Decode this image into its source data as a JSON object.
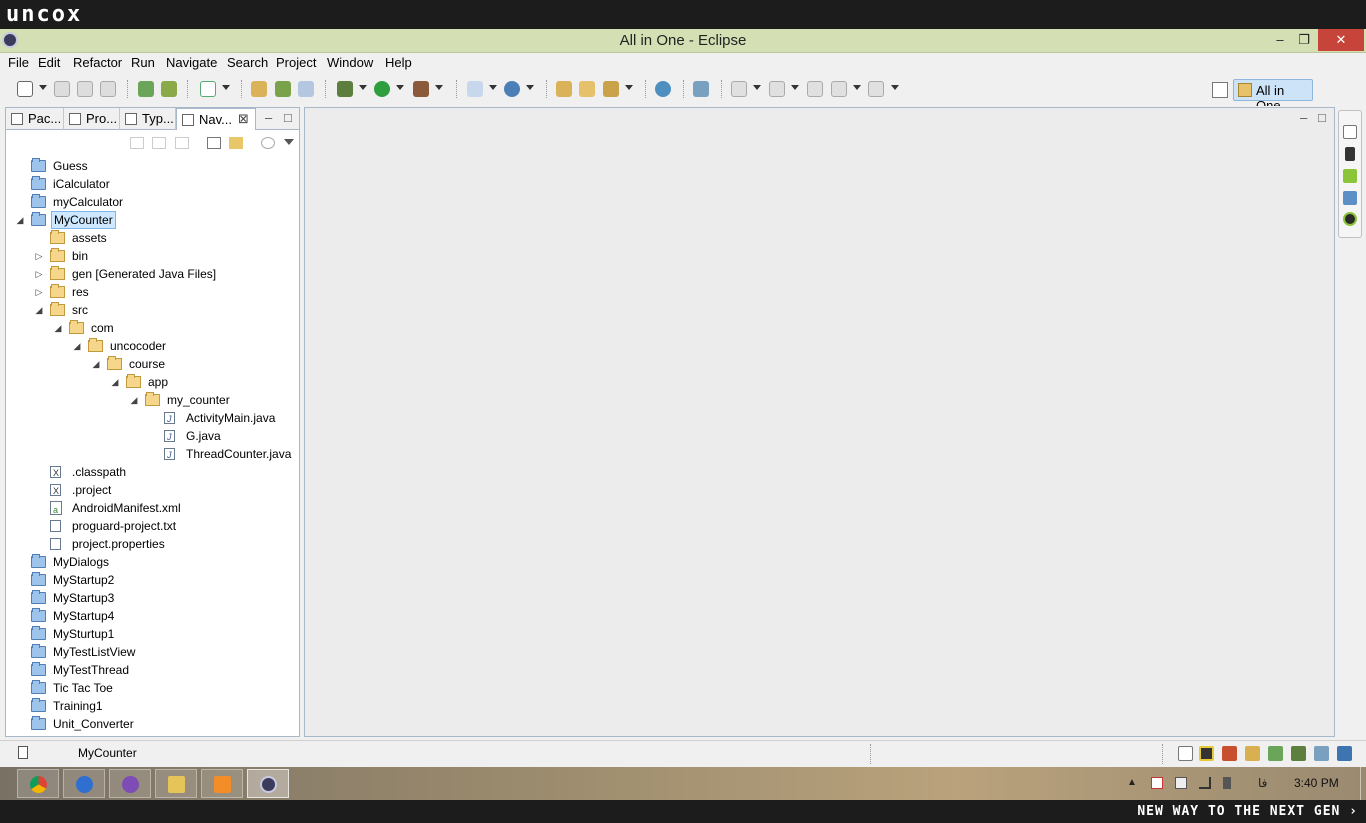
{
  "branding": {
    "logo": "uncox",
    "tagline": "NEW WAY TO THE NEXT GEN ›"
  },
  "window": {
    "title": "All in One - Eclipse",
    "minimize": "–",
    "maximize": "❐",
    "close": "✕"
  },
  "menubar": {
    "items": [
      "File",
      "Edit",
      "Refactor",
      "Run",
      "Navigate",
      "Search",
      "Project",
      "Window",
      "Help"
    ]
  },
  "perspective": {
    "label": "All in One"
  },
  "view": {
    "tabs": [
      "Pac...",
      "Pro...",
      "Typ...",
      "Nav..."
    ],
    "active_tab_index": 3,
    "close_glyph": "⊠",
    "minimize": "–",
    "maximize": "□"
  },
  "editor": {
    "minimize": "–",
    "maximize": "□"
  },
  "tree": {
    "items": [
      {
        "label": "Guess",
        "icon": "project-folder-icon",
        "depth": 0,
        "toggle": ""
      },
      {
        "label": "iCalculator",
        "icon": "project-folder-icon",
        "depth": 0,
        "toggle": ""
      },
      {
        "label": "myCalculator",
        "icon": "project-folder-icon",
        "depth": 0,
        "toggle": ""
      },
      {
        "label": "MyCounter",
        "icon": "project-open-icon",
        "depth": 0,
        "toggle": "◢",
        "selected": true
      },
      {
        "label": "assets",
        "icon": "folder-open-icon",
        "depth": 1,
        "toggle": ""
      },
      {
        "label": "bin",
        "icon": "folder-icon",
        "depth": 1,
        "toggle": "▷"
      },
      {
        "label": "gen [Generated Java Files]",
        "icon": "folder-icon",
        "depth": 1,
        "toggle": "▷"
      },
      {
        "label": "res",
        "icon": "folder-icon",
        "depth": 1,
        "toggle": "▷"
      },
      {
        "label": "src",
        "icon": "folder-open-icon",
        "depth": 1,
        "toggle": "◢"
      },
      {
        "label": "com",
        "icon": "folder-open-icon",
        "depth": 2,
        "toggle": "◢"
      },
      {
        "label": "uncocoder",
        "icon": "folder-open-icon",
        "depth": 3,
        "toggle": "◢"
      },
      {
        "label": "course",
        "icon": "folder-open-icon",
        "depth": 4,
        "toggle": "◢"
      },
      {
        "label": "app",
        "icon": "folder-open-icon",
        "depth": 5,
        "toggle": "◢"
      },
      {
        "label": "my_counter",
        "icon": "folder-open-icon",
        "depth": 6,
        "toggle": "◢"
      },
      {
        "label": "ActivityMain.java",
        "icon": "java-file-icon",
        "depth": 7,
        "toggle": ""
      },
      {
        "label": "G.java",
        "icon": "java-file-icon",
        "depth": 7,
        "toggle": ""
      },
      {
        "label": "ThreadCounter.java",
        "icon": "java-file-icon",
        "depth": 7,
        "toggle": ""
      },
      {
        "label": ".classpath",
        "icon": "xml-file-icon",
        "depth": 1,
        "toggle": ""
      },
      {
        "label": ".project",
        "icon": "xml-file-icon",
        "depth": 1,
        "toggle": ""
      },
      {
        "label": "AndroidManifest.xml",
        "icon": "android-manifest-icon",
        "depth": 1,
        "toggle": ""
      },
      {
        "label": "proguard-project.txt",
        "icon": "text-file-icon",
        "depth": 1,
        "toggle": ""
      },
      {
        "label": "project.properties",
        "icon": "text-file-icon",
        "depth": 1,
        "toggle": ""
      },
      {
        "label": "MyDialogs",
        "icon": "project-folder-icon",
        "depth": 0,
        "toggle": ""
      },
      {
        "label": "MyStartup2",
        "icon": "project-folder-icon",
        "depth": 0,
        "toggle": ""
      },
      {
        "label": "MyStartup3",
        "icon": "project-folder-icon",
        "depth": 0,
        "toggle": ""
      },
      {
        "label": "MyStartup4",
        "icon": "project-folder-icon",
        "depth": 0,
        "toggle": ""
      },
      {
        "label": "MySturtup1",
        "icon": "project-folder-icon",
        "depth": 0,
        "toggle": ""
      },
      {
        "label": "MyTestListView",
        "icon": "project-folder-icon",
        "depth": 0,
        "toggle": ""
      },
      {
        "label": "MyTestThread",
        "icon": "project-folder-icon",
        "depth": 0,
        "toggle": ""
      },
      {
        "label": "Tic Tac Toe",
        "icon": "project-folder-icon",
        "depth": 0,
        "toggle": ""
      },
      {
        "label": "Training1",
        "icon": "project-folder-icon",
        "depth": 0,
        "toggle": ""
      },
      {
        "label": "Unit_Converter",
        "icon": "project-folder-icon",
        "depth": 0,
        "toggle": ""
      }
    ]
  },
  "statusbar": {
    "text": "MyCounter"
  },
  "taskbar": {
    "apps": [
      "chrome-icon",
      "itunes-icon",
      "viber-icon",
      "file-explorer-icon",
      "media-player-icon",
      "eclipse-icon"
    ],
    "tray_up": "▲",
    "language": "فا",
    "clock": "3:40 PM"
  },
  "colors": {
    "titlebar": "#d4dfb4",
    "selection": "#cde8ff",
    "close_button": "#c7443a",
    "project_folder": "#9ec4ec",
    "folder": "#f5d68b"
  }
}
